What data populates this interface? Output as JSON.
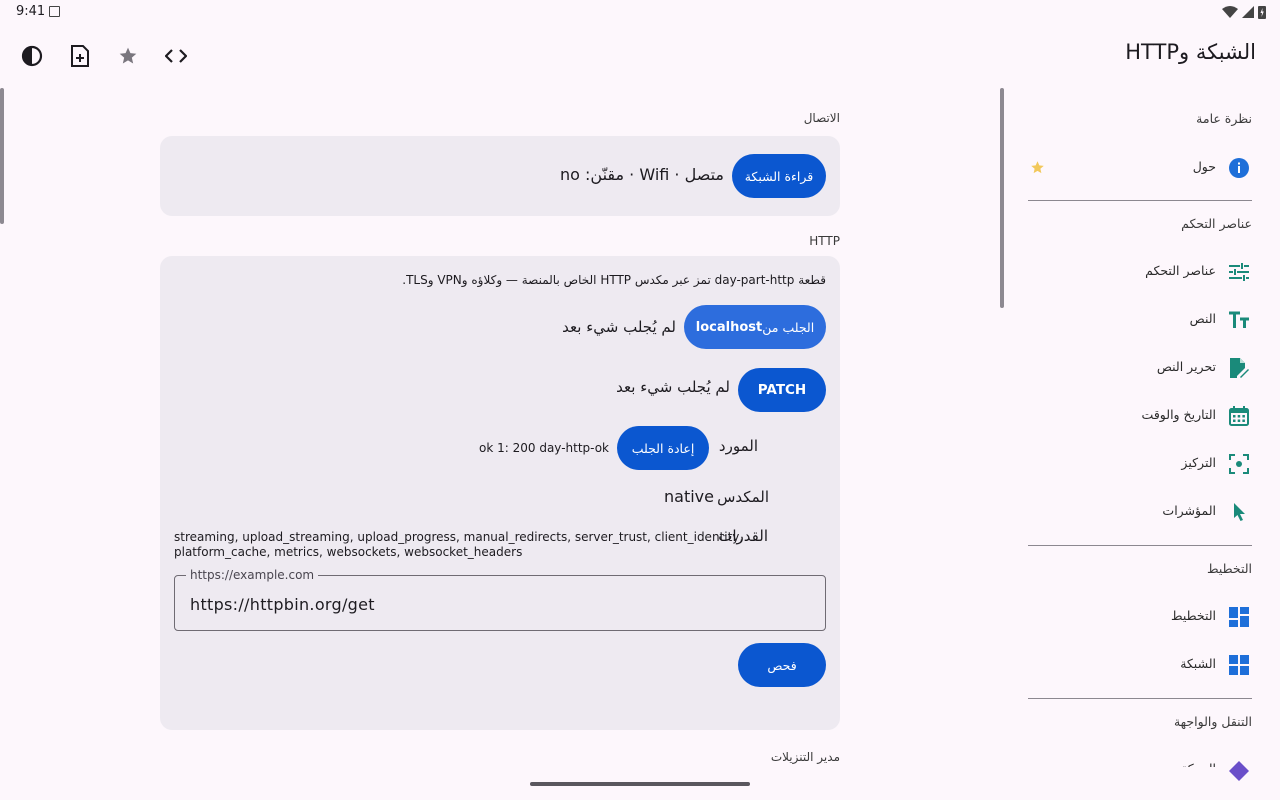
{
  "status_bar": {
    "time": "9:41"
  },
  "app_bar": {
    "title": "الشبكة وHTTP",
    "icons": [
      "contrast-icon",
      "new-document-icon",
      "star-icon",
      "code-icon"
    ]
  },
  "connectivity": {
    "section_label": "الاتصال",
    "button_label": "قراءة الشبكة",
    "status_text": "متصل · Wifi · مقنّن: no"
  },
  "http": {
    "section_label": "HTTP",
    "description": "قطعة day-part-http تمز عبر مكدس HTTP الخاص بالمنصة — وكلاؤه وVPN وTLS.",
    "fetch_localhost": {
      "label_prefix": "الجلب من ",
      "label_bold": "localhost",
      "result": "لم يُجلب شيء بعد"
    },
    "patch": {
      "label": "PATCH",
      "result": "لم يُجلب شيء بعد"
    },
    "resource": {
      "label": "المورد",
      "button_label": "إعادة الجلب",
      "value": "ok 1: 200 day-http-ok"
    },
    "stack": {
      "label": "المكدس",
      "value": "native"
    },
    "capabilities": {
      "label": "القدرات",
      "value_line1": "streaming, upload_streaming, upload_progress, manual_redirects, server_trust, client_identity,",
      "value_line2": "platform_cache, metrics, websockets, websocket_headers"
    },
    "url_field": {
      "label": "https://example.com",
      "value": "https://httpbin.org/get"
    },
    "check_button": "فحص"
  },
  "downloads": {
    "section_label": "مدير التنزيلات"
  },
  "sidebar": {
    "overview": {
      "heading": "نظرة عامة",
      "items": [
        {
          "label": "حول",
          "icon": "info-icon",
          "starred": true
        }
      ]
    },
    "controls": {
      "heading": "عناصر التحكم",
      "items": [
        {
          "label": "عناصر التحكم",
          "icon": "tune-icon"
        },
        {
          "label": "النص",
          "icon": "text-fields-icon"
        },
        {
          "label": "تحرير النص",
          "icon": "edit-document-icon"
        },
        {
          "label": "التاريخ والوقت",
          "icon": "calendar-icon"
        },
        {
          "label": "التركيز",
          "icon": "focus-icon"
        },
        {
          "label": "المؤشرات",
          "icon": "pointer-icon"
        }
      ]
    },
    "layout": {
      "heading": "التخطيط",
      "items": [
        {
          "label": "التخطيط",
          "icon": "dashboard-icon"
        },
        {
          "label": "الشبكة",
          "icon": "grid-icon"
        }
      ]
    },
    "navigation": {
      "heading": "التنقل والواجهة",
      "items": [
        {
          "label": "الحركة",
          "icon": "diamond-icon"
        }
      ]
    }
  },
  "colors": {
    "background": "#fdf7fc",
    "card": "#eeeaf1",
    "primary_button": "#0b57d0",
    "nav_icon_teal": "#1a8a7a",
    "nav_icon_blue": "#1e6fd9"
  }
}
